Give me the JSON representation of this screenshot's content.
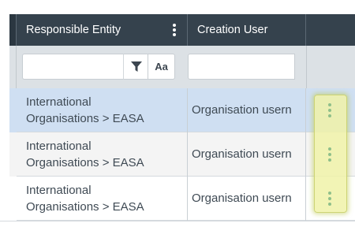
{
  "header": {
    "col1_label": "Responsible Entity",
    "col2_label": "Creation User"
  },
  "filter": {
    "col1_value": "",
    "case_toggle_label": "Aa",
    "col2_value": ""
  },
  "rows": [
    {
      "entity_line1": "International",
      "entity_line2": "Organisations > EASA",
      "creation_user": "Organisation usern"
    },
    {
      "entity_line1": "International",
      "entity_line2": "Organisations > EASA",
      "creation_user": "Organisation usern"
    },
    {
      "entity_line1": "International",
      "entity_line2": "Organisations > EASA",
      "creation_user": "Organisation usern"
    }
  ],
  "colors": {
    "header_bg": "#35424d",
    "selected_row_bg": "#cfdff2",
    "highlight": "#f0f2a8",
    "action_dots": "#8fbf8a"
  }
}
